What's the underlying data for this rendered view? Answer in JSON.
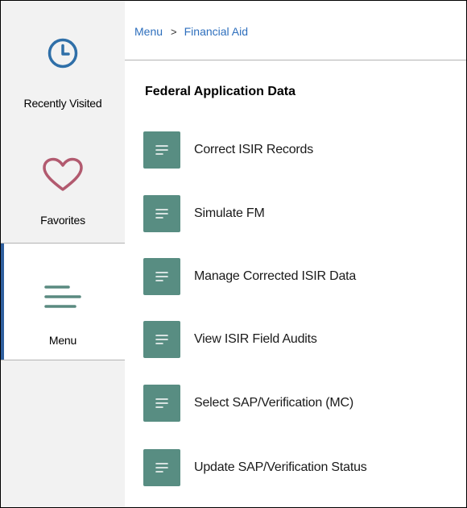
{
  "sidebar": {
    "recently_visited": {
      "label": "Recently Visited",
      "icon": "clock-icon",
      "color": "#2f6fa8"
    },
    "favorites": {
      "label": "Favorites",
      "icon": "heart-icon",
      "color": "#b25a6f"
    },
    "menu": {
      "label": "Menu",
      "icon": "menu-lines-icon",
      "color": "#5a8a80",
      "active": true
    }
  },
  "breadcrumb": {
    "items": [
      "Menu",
      "Financial Aid"
    ],
    "separator": ">"
  },
  "section": {
    "title": "Federal Application Data"
  },
  "links": [
    {
      "label": "Correct ISIR Records",
      "icon": "document-lines-icon"
    },
    {
      "label": "Simulate FM",
      "icon": "document-lines-icon"
    },
    {
      "label": "Manage Corrected ISIR Data",
      "icon": "document-lines-icon"
    },
    {
      "label": "View ISIR Field Audits",
      "icon": "document-lines-icon"
    },
    {
      "label": "Select SAP/Verification (MC)",
      "icon": "document-lines-icon"
    },
    {
      "label": "Update SAP/Verification Status",
      "icon": "document-lines-icon"
    }
  ],
  "colors": {
    "link_text": "#2e6fbd",
    "tile": "#588d82",
    "active_indicator": "#2f5f9e",
    "sidebar_bg": "#f2f2f2"
  }
}
